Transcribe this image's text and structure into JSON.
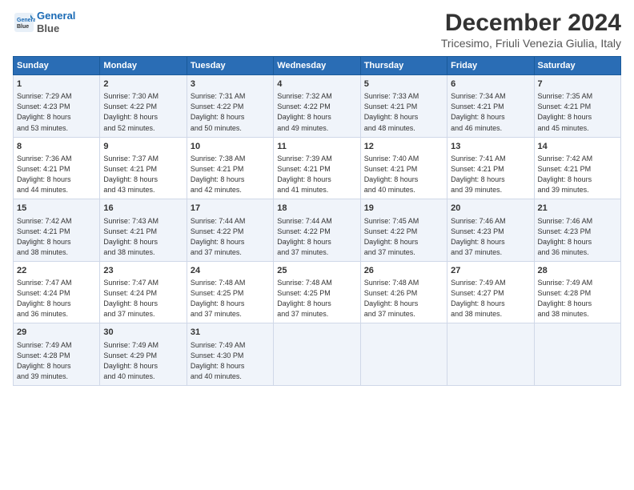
{
  "logo": {
    "line1": "General",
    "line2": "Blue"
  },
  "title": "December 2024",
  "subtitle": "Tricesimo, Friuli Venezia Giulia, Italy",
  "days_header": [
    "Sunday",
    "Monday",
    "Tuesday",
    "Wednesday",
    "Thursday",
    "Friday",
    "Saturday"
  ],
  "weeks": [
    [
      {
        "day": "1",
        "lines": [
          "Sunrise: 7:29 AM",
          "Sunset: 4:23 PM",
          "Daylight: 8 hours",
          "and 53 minutes."
        ]
      },
      {
        "day": "2",
        "lines": [
          "Sunrise: 7:30 AM",
          "Sunset: 4:22 PM",
          "Daylight: 8 hours",
          "and 52 minutes."
        ]
      },
      {
        "day": "3",
        "lines": [
          "Sunrise: 7:31 AM",
          "Sunset: 4:22 PM",
          "Daylight: 8 hours",
          "and 50 minutes."
        ]
      },
      {
        "day": "4",
        "lines": [
          "Sunrise: 7:32 AM",
          "Sunset: 4:22 PM",
          "Daylight: 8 hours",
          "and 49 minutes."
        ]
      },
      {
        "day": "5",
        "lines": [
          "Sunrise: 7:33 AM",
          "Sunset: 4:21 PM",
          "Daylight: 8 hours",
          "and 48 minutes."
        ]
      },
      {
        "day": "6",
        "lines": [
          "Sunrise: 7:34 AM",
          "Sunset: 4:21 PM",
          "Daylight: 8 hours",
          "and 46 minutes."
        ]
      },
      {
        "day": "7",
        "lines": [
          "Sunrise: 7:35 AM",
          "Sunset: 4:21 PM",
          "Daylight: 8 hours",
          "and 45 minutes."
        ]
      }
    ],
    [
      {
        "day": "8",
        "lines": [
          "Sunrise: 7:36 AM",
          "Sunset: 4:21 PM",
          "Daylight: 8 hours",
          "and 44 minutes."
        ]
      },
      {
        "day": "9",
        "lines": [
          "Sunrise: 7:37 AM",
          "Sunset: 4:21 PM",
          "Daylight: 8 hours",
          "and 43 minutes."
        ]
      },
      {
        "day": "10",
        "lines": [
          "Sunrise: 7:38 AM",
          "Sunset: 4:21 PM",
          "Daylight: 8 hours",
          "and 42 minutes."
        ]
      },
      {
        "day": "11",
        "lines": [
          "Sunrise: 7:39 AM",
          "Sunset: 4:21 PM",
          "Daylight: 8 hours",
          "and 41 minutes."
        ]
      },
      {
        "day": "12",
        "lines": [
          "Sunrise: 7:40 AM",
          "Sunset: 4:21 PM",
          "Daylight: 8 hours",
          "and 40 minutes."
        ]
      },
      {
        "day": "13",
        "lines": [
          "Sunrise: 7:41 AM",
          "Sunset: 4:21 PM",
          "Daylight: 8 hours",
          "and 39 minutes."
        ]
      },
      {
        "day": "14",
        "lines": [
          "Sunrise: 7:42 AM",
          "Sunset: 4:21 PM",
          "Daylight: 8 hours",
          "and 39 minutes."
        ]
      }
    ],
    [
      {
        "day": "15",
        "lines": [
          "Sunrise: 7:42 AM",
          "Sunset: 4:21 PM",
          "Daylight: 8 hours",
          "and 38 minutes."
        ]
      },
      {
        "day": "16",
        "lines": [
          "Sunrise: 7:43 AM",
          "Sunset: 4:21 PM",
          "Daylight: 8 hours",
          "and 38 minutes."
        ]
      },
      {
        "day": "17",
        "lines": [
          "Sunrise: 7:44 AM",
          "Sunset: 4:22 PM",
          "Daylight: 8 hours",
          "and 37 minutes."
        ]
      },
      {
        "day": "18",
        "lines": [
          "Sunrise: 7:44 AM",
          "Sunset: 4:22 PM",
          "Daylight: 8 hours",
          "and 37 minutes."
        ]
      },
      {
        "day": "19",
        "lines": [
          "Sunrise: 7:45 AM",
          "Sunset: 4:22 PM",
          "Daylight: 8 hours",
          "and 37 minutes."
        ]
      },
      {
        "day": "20",
        "lines": [
          "Sunrise: 7:46 AM",
          "Sunset: 4:23 PM",
          "Daylight: 8 hours",
          "and 37 minutes."
        ]
      },
      {
        "day": "21",
        "lines": [
          "Sunrise: 7:46 AM",
          "Sunset: 4:23 PM",
          "Daylight: 8 hours",
          "and 36 minutes."
        ]
      }
    ],
    [
      {
        "day": "22",
        "lines": [
          "Sunrise: 7:47 AM",
          "Sunset: 4:24 PM",
          "Daylight: 8 hours",
          "and 36 minutes."
        ]
      },
      {
        "day": "23",
        "lines": [
          "Sunrise: 7:47 AM",
          "Sunset: 4:24 PM",
          "Daylight: 8 hours",
          "and 37 minutes."
        ]
      },
      {
        "day": "24",
        "lines": [
          "Sunrise: 7:48 AM",
          "Sunset: 4:25 PM",
          "Daylight: 8 hours",
          "and 37 minutes."
        ]
      },
      {
        "day": "25",
        "lines": [
          "Sunrise: 7:48 AM",
          "Sunset: 4:25 PM",
          "Daylight: 8 hours",
          "and 37 minutes."
        ]
      },
      {
        "day": "26",
        "lines": [
          "Sunrise: 7:48 AM",
          "Sunset: 4:26 PM",
          "Daylight: 8 hours",
          "and 37 minutes."
        ]
      },
      {
        "day": "27",
        "lines": [
          "Sunrise: 7:49 AM",
          "Sunset: 4:27 PM",
          "Daylight: 8 hours",
          "and 38 minutes."
        ]
      },
      {
        "day": "28",
        "lines": [
          "Sunrise: 7:49 AM",
          "Sunset: 4:28 PM",
          "Daylight: 8 hours",
          "and 38 minutes."
        ]
      }
    ],
    [
      {
        "day": "29",
        "lines": [
          "Sunrise: 7:49 AM",
          "Sunset: 4:28 PM",
          "Daylight: 8 hours",
          "and 39 minutes."
        ]
      },
      {
        "day": "30",
        "lines": [
          "Sunrise: 7:49 AM",
          "Sunset: 4:29 PM",
          "Daylight: 8 hours",
          "and 40 minutes."
        ]
      },
      {
        "day": "31",
        "lines": [
          "Sunrise: 7:49 AM",
          "Sunset: 4:30 PM",
          "Daylight: 8 hours",
          "and 40 minutes."
        ]
      },
      null,
      null,
      null,
      null
    ]
  ]
}
